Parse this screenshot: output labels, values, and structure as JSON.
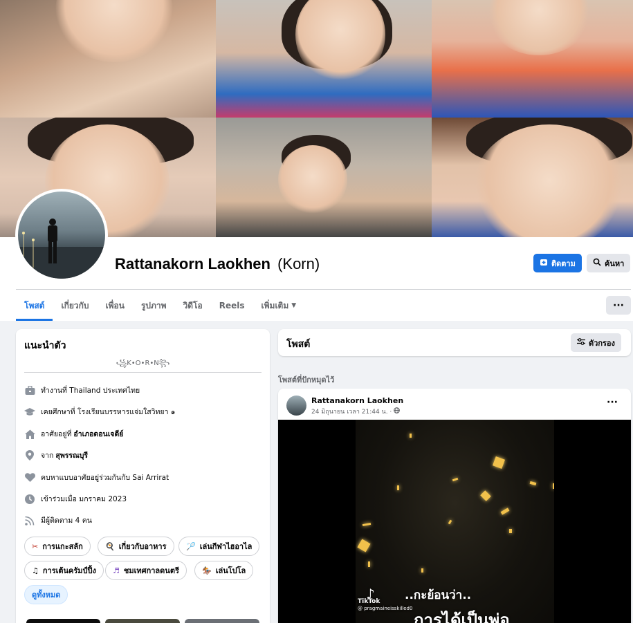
{
  "colors": {
    "accent": "#1b74e4",
    "page_bg": "#f0f2f5",
    "card_bg": "#ffffff",
    "muted_text": "#65676b"
  },
  "profile": {
    "name": "Rattanakorn Laokhen",
    "nickname": "(Korn)",
    "follow_label": "ติดตาม",
    "search_label": "ค้นหา",
    "more_label": "···"
  },
  "tabs": [
    {
      "label": "โพสต์",
      "active": true
    },
    {
      "label": "เกี่ยวกับ"
    },
    {
      "label": "เพื่อน"
    },
    {
      "label": "รูปภาพ"
    },
    {
      "label": "วิดีโอ"
    },
    {
      "label": "Reels"
    },
    {
      "label": "เพิ่มเติม"
    }
  ],
  "intro": {
    "title": "แนะนำตัว",
    "bio": "꧁K•O•R•N꧂",
    "details": [
      {
        "icon": "briefcase-icon",
        "prefix": "ทำงานที่ Thailand ประเทศไทย",
        "bold": ""
      },
      {
        "icon": "graduation-cap-icon",
        "prefix": "เคยศึกษาที่ โรงเรียนบรรหารแจ่มใสวิทยา ๑",
        "bold": ""
      },
      {
        "icon": "home-icon",
        "prefix": "อาศัยอยู่ที่",
        "bold": "อำเภอดอนเจดีย์"
      },
      {
        "icon": "location-pin-icon",
        "prefix": "จาก",
        "bold": "สุพรรณบุรี"
      },
      {
        "icon": "heart-icon",
        "prefix": "คบหาแบบอาศัยอยู่ร่วมกันกับ Sai Arrirat",
        "bold": ""
      },
      {
        "icon": "clock-icon",
        "prefix": "เข้าร่วมเมื่อ มกราคม 2023",
        "bold": ""
      },
      {
        "icon": "rss-icon",
        "prefix": "มีผู้ติดตาม 4 คน",
        "bold": ""
      }
    ],
    "hobbies": [
      {
        "icon": "carving-icon",
        "label": "การแกะสลัก"
      },
      {
        "icon": "food-icon",
        "label": "เกี่ยวกับอาหาร"
      },
      {
        "icon": "badminton-icon",
        "label": "เล่นกีฬาไฮอาไล"
      },
      {
        "icon": "music-note-icon",
        "label": "การเต้นครัมป์ปิ้ง"
      },
      {
        "icon": "music-festival-icon",
        "label": "ชมเทศกาลดนตรี"
      },
      {
        "icon": "polo-icon",
        "label": "เล่นโปโล"
      }
    ],
    "see_all_label": "ดูทั้งหมด"
  },
  "posts": {
    "title": "โพสต์",
    "filter_label": "ตัวกรอง",
    "pinned_label": "โพสต์ที่ปักหมุดไว้",
    "post": {
      "author": "Rattanakorn Laokhen",
      "meta": "24 มิถุนายน เวลา 21:44 น. ·",
      "video_caption_line1": "..กะย้อนว่า..",
      "video_caption_line2": "การได้เป็นพ่อ",
      "tiktok_brand": "TikTok",
      "tiktok_handle": "@ pragmaineisskilled0"
    }
  }
}
